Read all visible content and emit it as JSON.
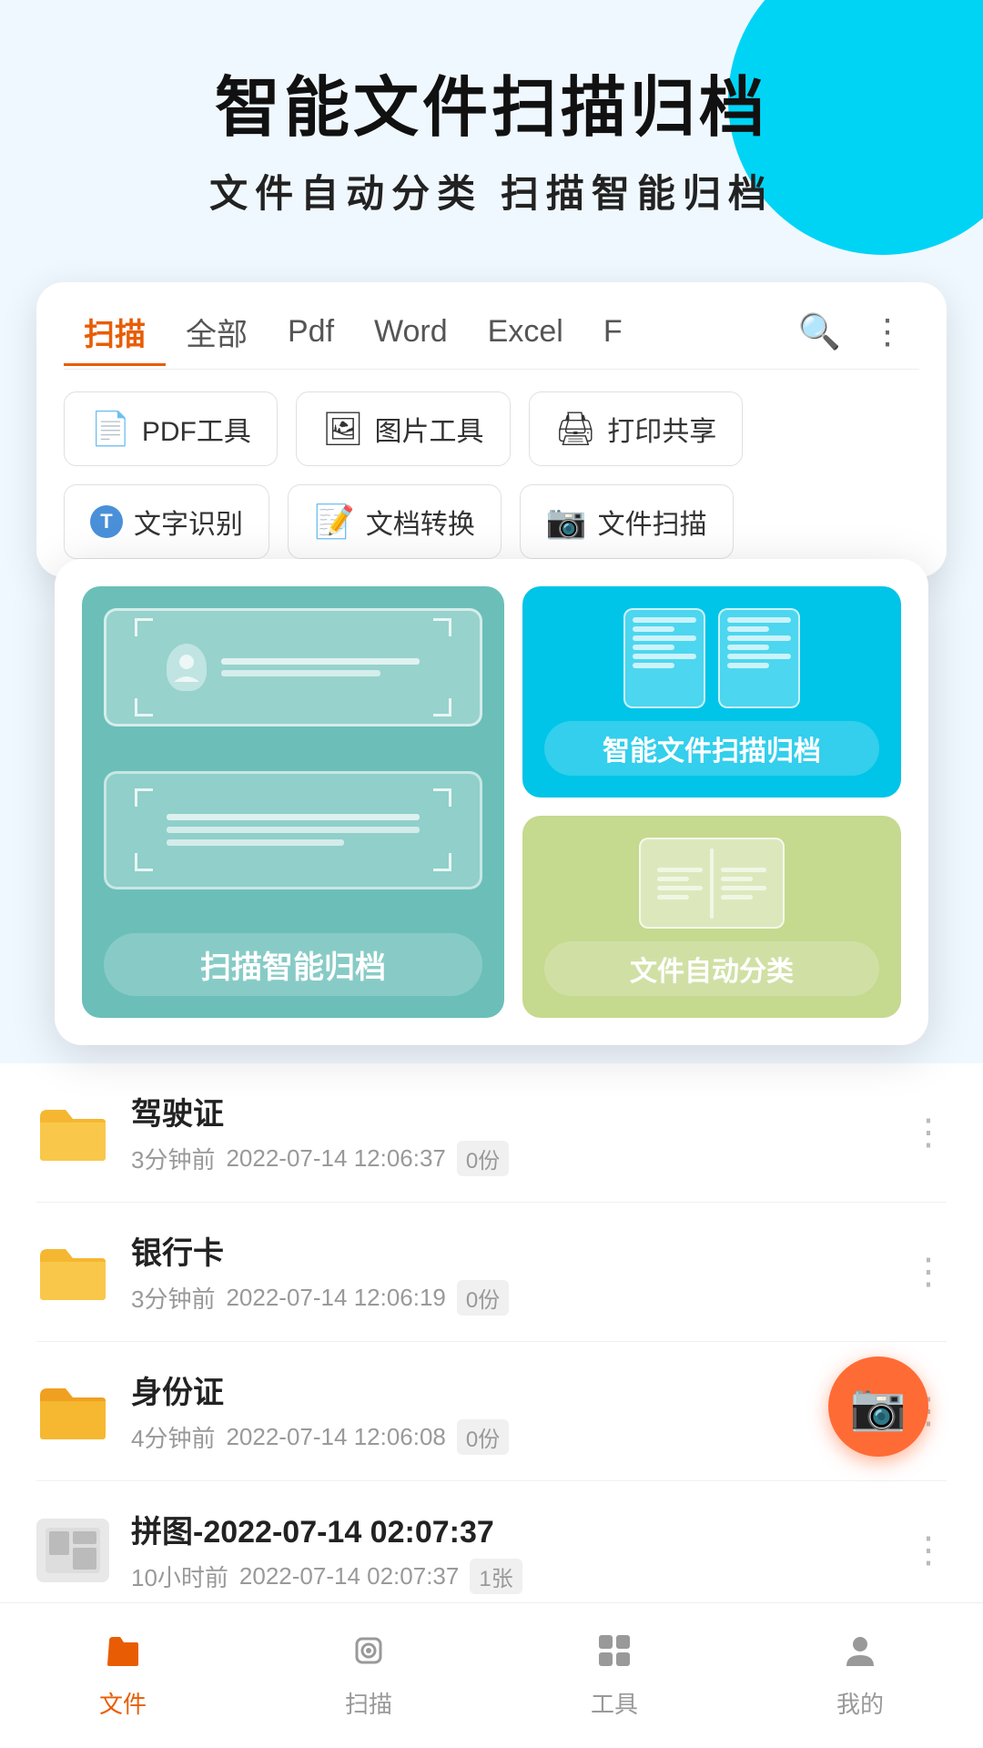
{
  "header": {
    "main_title": "智能文件扫描归档",
    "sub_title": "文件自动分类   扫描智能归档"
  },
  "tabs": {
    "items": [
      {
        "label": "扫描",
        "active": true
      },
      {
        "label": "全部",
        "active": false
      },
      {
        "label": "Pdf",
        "active": false
      },
      {
        "label": "Word",
        "active": false
      },
      {
        "label": "Excel",
        "active": false
      },
      {
        "label": "F",
        "active": false
      }
    ]
  },
  "tools": {
    "row1": [
      {
        "label": "PDF工具",
        "icon": "📄"
      },
      {
        "label": "图片工具",
        "icon": "🖼"
      },
      {
        "label": "打印共享",
        "icon": "🖨"
      }
    ],
    "row2": [
      {
        "label": "文字识别",
        "icon": "T"
      },
      {
        "label": "文档转换",
        "icon": "W"
      },
      {
        "label": "文件扫描",
        "icon": "📷"
      }
    ]
  },
  "features": {
    "left_label": "扫描智能归档",
    "top_right_label": "智能文件扫描归档",
    "bottom_right_label": "文件自动分类"
  },
  "files": [
    {
      "name": "驾驶证",
      "time": "3分钟前",
      "date": "2022-07-14 12:06:37",
      "count": "0份",
      "type": "folder"
    },
    {
      "name": "银行卡",
      "time": "3分钟前",
      "date": "2022-07-14 12:06:19",
      "count": "0份",
      "type": "folder"
    },
    {
      "name": "身份证",
      "time": "4分钟前",
      "date": "2022-07-14 12:06:08",
      "count": "0份",
      "type": "folder"
    },
    {
      "name": "拼图-2022-07-14 02:07:37",
      "time": "10小时前",
      "date": "2022-07-14 02:07:37",
      "count": "1张",
      "type": "image"
    }
  ],
  "nav": {
    "items": [
      {
        "label": "文件",
        "active": true,
        "icon": "📁"
      },
      {
        "label": "扫描",
        "active": false,
        "icon": "📷"
      },
      {
        "label": "工具",
        "active": false,
        "icon": "⊞"
      },
      {
        "label": "我的",
        "active": false,
        "icon": "👤"
      }
    ]
  }
}
